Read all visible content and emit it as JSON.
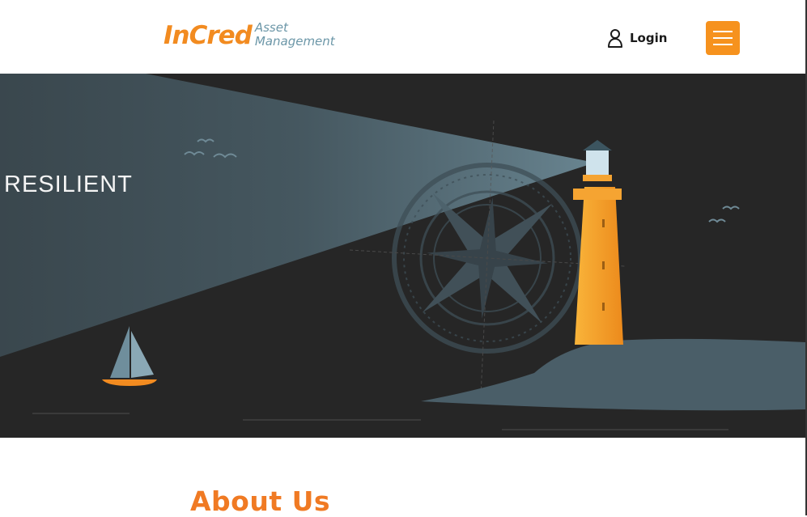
{
  "header": {
    "logo_main": "InCred",
    "logo_sub_line1": "Asset",
    "logo_sub_line2": "Management",
    "login_label": "Login",
    "menu_icon": "hamburger-icon",
    "login_icon": "user-icon"
  },
  "hero": {
    "headline": "RESILIENT",
    "illustration": "lighthouse-compass-sailboat"
  },
  "about": {
    "title": "About Us"
  },
  "colors": {
    "brand_orange": "#f28b20",
    "brand_teal": "#6c97a8",
    "hero_background": "#262626",
    "menu_button": "#f6921e",
    "about_title": "#f07a23"
  }
}
